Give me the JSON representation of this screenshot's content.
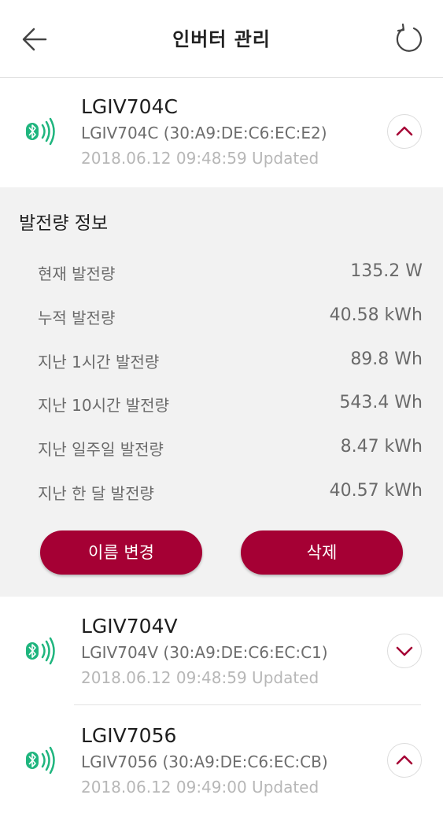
{
  "header": {
    "title": "인버터 관리"
  },
  "devices": [
    {
      "name": "LGIV704C",
      "mac": "LGIV704C (30:A9:DE:C6:EC:E2)",
      "updated": "2018.06.12 09:48:59 Updated",
      "expanded": true
    },
    {
      "name": "LGIV704V",
      "mac": "LGIV704V (30:A9:DE:C6:EC:C1)",
      "updated": "2018.06.12 09:48:59 Updated",
      "expanded": false
    },
    {
      "name": "LGIV7056",
      "mac": "LGIV7056 (30:A9:DE:C6:EC:CB)",
      "updated": "2018.06.12 09:49:00 Updated",
      "expanded": true
    }
  ],
  "details": {
    "title": "발전량 정보",
    "rows": [
      {
        "label": "현재 발전량",
        "value": "135.2 W"
      },
      {
        "label": "누적 발전량",
        "value": "40.58 kWh"
      },
      {
        "label": "지난 1시간 발전량",
        "value": "89.8 Wh"
      },
      {
        "label": "지난 10시간 발전량",
        "value": "543.4 Wh"
      },
      {
        "label": "지난 일주일 발전량",
        "value": "8.47 kWh"
      },
      {
        "label": "지난 한 달 발전량",
        "value": "40.57 kWh"
      }
    ],
    "rename_label": "이름 변경",
    "delete_label": "삭제"
  },
  "colors": {
    "accent": "#a50034",
    "bluetooth": "#1fb57e",
    "panel_bg": "#f2f2f2"
  },
  "icons": {
    "back": "arrow-left-icon",
    "refresh": "refresh-icon",
    "bluetooth": "bluetooth-signal-icon",
    "expand": "chevron-down-icon",
    "collapse": "chevron-up-icon"
  }
}
